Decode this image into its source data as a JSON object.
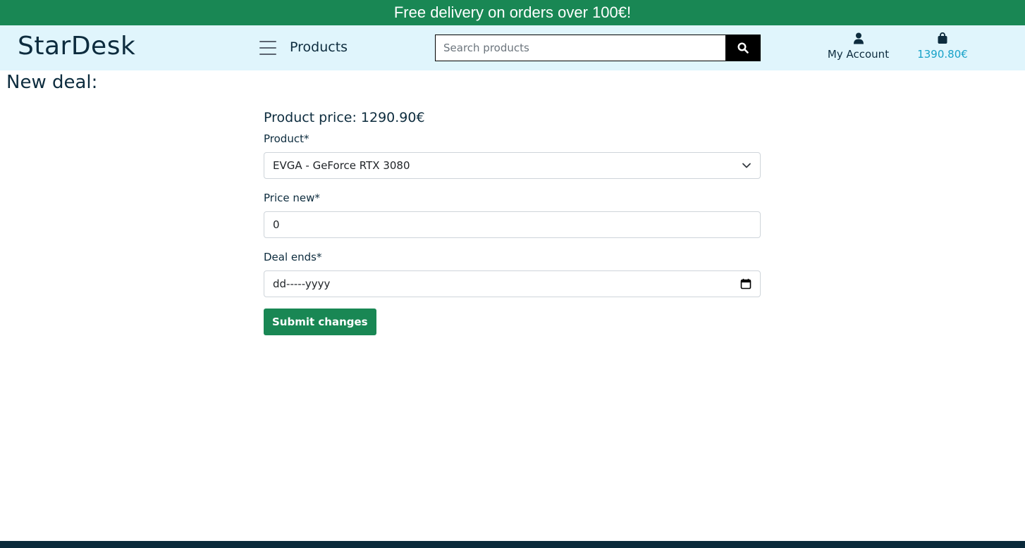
{
  "promo": {
    "text": "Free delivery on orders over 100€!"
  },
  "header": {
    "logo": "StarDesk",
    "nav_products": "Products",
    "search_placeholder": "Search products",
    "account_label": "My Account",
    "cart_total": "1390.80€"
  },
  "main": {
    "title": "New deal:",
    "product_price": "Product price: 1290.90€",
    "product_label": "Product*",
    "product_selected": "EVGA - GeForce RTX 3080",
    "price_new_label": "Price new*",
    "price_new_value": "0",
    "deal_ends_label": "Deal ends*",
    "deal_ends_placeholder": "dd-----yyyy",
    "submit_label": "Submit changes"
  },
  "colors": {
    "brand_green": "#198754",
    "header_bg": "#e0f5fc",
    "navy": "#0d2c3e",
    "cart_accent": "#17a2c8"
  }
}
